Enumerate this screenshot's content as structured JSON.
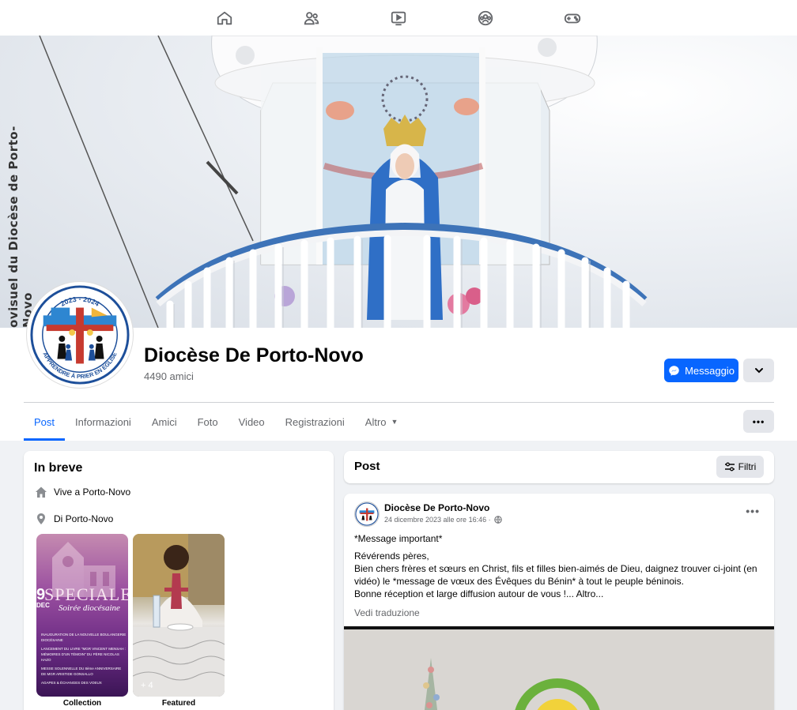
{
  "topnav": {
    "icons": [
      "home-icon",
      "friends-icon",
      "video-icon",
      "groups-icon",
      "gaming-icon"
    ]
  },
  "cover": {
    "side_text": "ovisuel du Diocèse de Porto-Novo"
  },
  "profile": {
    "avatar_text_top": "2023 - 2024",
    "avatar_text_bottom": "APPRENDRE À PRIER EN EGLISE",
    "name": "Diocèse De Porto-Novo",
    "friends": "4490 amici",
    "message_button": "Messaggio"
  },
  "tabs": [
    {
      "label": "Post",
      "active": true
    },
    {
      "label": "Informazioni"
    },
    {
      "label": "Amici"
    },
    {
      "label": "Foto"
    },
    {
      "label": "Video"
    },
    {
      "label": "Registrazioni"
    },
    {
      "label": "Altro",
      "dropdown": true
    }
  ],
  "tabs_more": "•••",
  "intro": {
    "title": "In breve",
    "lives_in": "Vive a Porto-Novo",
    "from": "Di Porto-Novo",
    "featured": [
      {
        "label": "Collection",
        "overlay": ""
      },
      {
        "label": "Featured",
        "overlay": "+ 4"
      }
    ],
    "collection_poster": {
      "big": "SPECIALE",
      "sub": "Soirée diocésaine",
      "date_num": "9",
      "date_month": "DEC",
      "lines": [
        "INAUGURATION DE LA NOUVELLE BOULANGERIE DIOCÉSAINE",
        "LANCEMENT DU LIVRE \"MGR VINCENT MENSAH : MÉMOIRES D'UN TÉMOIN\" DU PÈRE NICOLAS HAZO",
        "MESSE SOLENNELLE DU 8ème ANNIVERSAIRE DE MGR ARISTIDE GONSALLO",
        "AGAPES & ÉCHANGES DES VOEUX"
      ]
    }
  },
  "posts_header": {
    "title": "Post",
    "filter_label": "Filtri"
  },
  "post": {
    "author": "Diocèse De Porto-Novo",
    "time": "24 dicembre 2023 alle ore 16:46 ·",
    "lines": [
      "*Message important*",
      "Révérends pères,",
      "Bien chers frères et sœurs en Christ, fils et filles bien-aimés de Dieu, daignez trouver ci-joint (en vidéo) le *message de vœux des Évêques du Bénin* à tout le peuple béninois.",
      "Bonne réception et large diffusion autour de vous !... Altro..."
    ],
    "translate": "Vedi traduzione"
  },
  "colors": {
    "accent": "#0866ff",
    "background": "#f0f2f5",
    "secondary_text": "#65676b"
  }
}
